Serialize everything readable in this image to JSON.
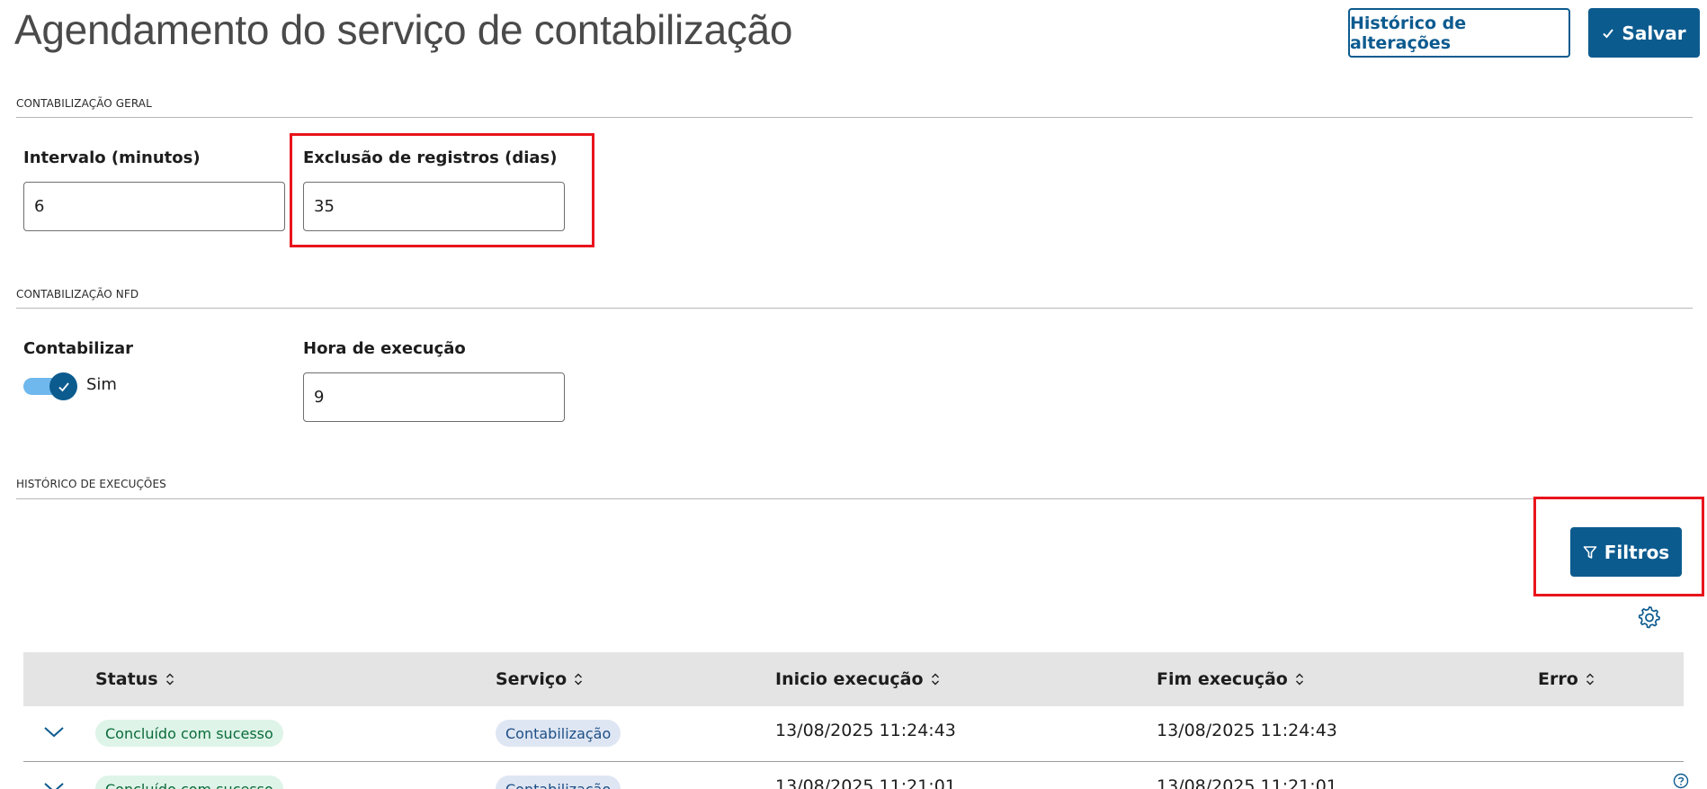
{
  "page": {
    "title": "Agendamento do serviço de contabilização"
  },
  "toolbar": {
    "history_label": "Histórico de alterações",
    "save_label": "Salvar"
  },
  "sections": {
    "geral": {
      "title": "CONTABILIZAÇÃO GERAL",
      "interval_label": "Intervalo (minutos)",
      "interval_value": "6",
      "exclusion_label": "Exclusão de registros (dias)",
      "exclusion_value": "35"
    },
    "nfd": {
      "title": "CONTABILIZAÇÃO NFD",
      "contabilizar_label": "Contabilizar",
      "contabilizar_on": true,
      "toggle_text": "Sim",
      "hora_label": "Hora de execução",
      "hora_value": "9"
    },
    "historico": {
      "title": "HISTÓRICO DE EXECUÇÕES",
      "filter_label": "Filtros"
    }
  },
  "table": {
    "columns": [
      "Status",
      "Serviço",
      "Inicio execução",
      "Fim execução",
      "Erro"
    ],
    "rows": [
      {
        "status": "Concluído com sucesso",
        "servico": "Contabilização",
        "inicio": "13/08/2025 11:24:43",
        "fim": "13/08/2025 11:24:43",
        "erro": ""
      },
      {
        "status": "Concluído com sucesso",
        "servico": "Contabilização",
        "inicio": "13/08/2025 11:21:01",
        "fim": "13/08/2025 11:21:01",
        "erro": ""
      }
    ]
  },
  "icons": {
    "save": "check-icon",
    "filter": "filter-icon",
    "settings": "gear-icon",
    "expand": "chevron-down-icon",
    "sort": "sort-icon",
    "help": "help-icon"
  },
  "colors": {
    "primary": "#0c5b8f",
    "highlight": "#e8141c",
    "success_badge_bg": "#def4e8",
    "service_badge_bg": "#dfe6f3",
    "header_bg": "#e4e4e4"
  }
}
